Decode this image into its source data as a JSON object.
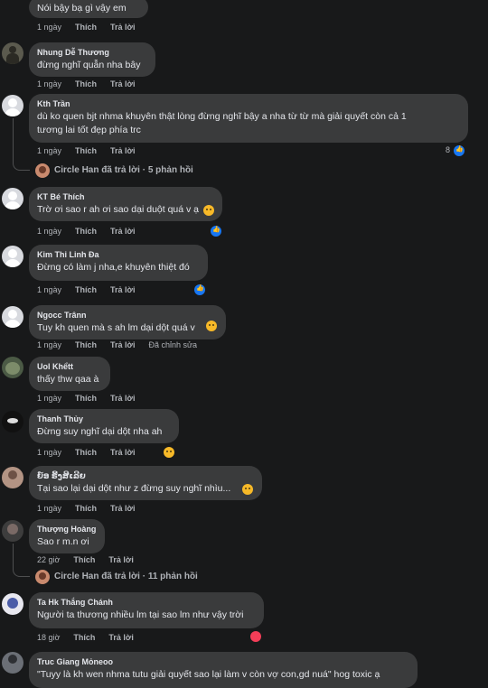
{
  "comments": [
    {
      "name": "",
      "text": "Nói bậy bạ gì vậy em",
      "time": "1 ngày",
      "like": "Thích",
      "reply": "Trả lời"
    },
    {
      "name": "Nhung Dễ Thương",
      "text": "đừng nghĩ quẫn nha bây",
      "time": "1 ngày",
      "like": "Thích",
      "reply": "Trả lời"
    },
    {
      "name": "Kth Trần",
      "text_line1": "dù ko quen bjt nhma khuyên thật lòng đừng nghĩ bậy a nha từ từ mà giải quyết còn cả 1",
      "text_line2": "tương lai tốt đẹp phía trc",
      "time": "1 ngày",
      "like": "Thích",
      "reply": "Trả lời",
      "reaction_count": "8",
      "reaction_icon": "like-icon"
    },
    {
      "name": "KT Bé Thích",
      "text": "Trờ ơi sao r ah ơi sao dại duột quá v ạ",
      "time": "1 ngày",
      "like": "Thích",
      "reply": "Trả lời",
      "emoji": "downcast-face-icon",
      "reaction_icon": "like-icon"
    },
    {
      "name": "Kim Thi Linh Đa",
      "text": "Đừng có làm j nha,e khuyên thiệt đó",
      "time": "1 ngày",
      "like": "Thích",
      "reply": "Trả lời",
      "reaction_icon": "like-icon"
    },
    {
      "name": "Ngocc Trânn",
      "text": "Tuy kh quen mà s ah lm dại dột quá v",
      "time": "1 ngày",
      "like": "Thích",
      "reply": "Trả lời",
      "edited": "Đã chỉnh sửa",
      "emoji": "crying-face-icon"
    },
    {
      "name": "Uol Khểtt",
      "text": "thấy thw qaa à",
      "time": "1 ngày",
      "like": "Thích",
      "reply": "Trả lời"
    },
    {
      "name": "Thanh Thủy",
      "text": "Đừng suy nghĩ dại dột nha ah",
      "time": "1 ngày",
      "like": "Thích",
      "reply": "Trả lời",
      "reaction_icon": "wow-icon"
    },
    {
      "name": "ຍ໌ອ ຣີ້ງສີເລີຍ",
      "text": "Tại sao lại dại dột như z đừng suy nghĩ nhìu...",
      "time": "1 ngày",
      "like": "Thích",
      "reply": "Trả lời",
      "emoji": "sad-face-icon"
    },
    {
      "name": "Thượng Hoàng",
      "text": "Sao r m.n ơi",
      "time": "22 giờ",
      "like": "Thích",
      "reply": "Trả lời"
    },
    {
      "name": "Ta Hk Thắng Chánh",
      "text": "Người ta thương nhiều lm tại sao lm như vậy trời",
      "time": "18 giờ",
      "like": "Thích",
      "reply": "Trả lời",
      "reaction_icon": "love-icon"
    },
    {
      "name": "Truc Giang Mỏneoo",
      "text": "\"Tuyy là kh wen nhma tutu giải quyết sao lại làm v còn vợ con,gd nuá\" hog toxic ạ"
    }
  ],
  "replies": [
    {
      "author": "Circle Han",
      "label": "đã trả lời",
      "count": "5 phản hồi"
    },
    {
      "author": "Circle Han",
      "label": "đã trả lời",
      "count": "11 phản hồi"
    }
  ],
  "colors": {
    "background": "#18191a",
    "bubble": "#3a3b3c",
    "meta": "#b0b3b8",
    "like_blue": "#1877f2",
    "love_red": "#f33e58"
  }
}
